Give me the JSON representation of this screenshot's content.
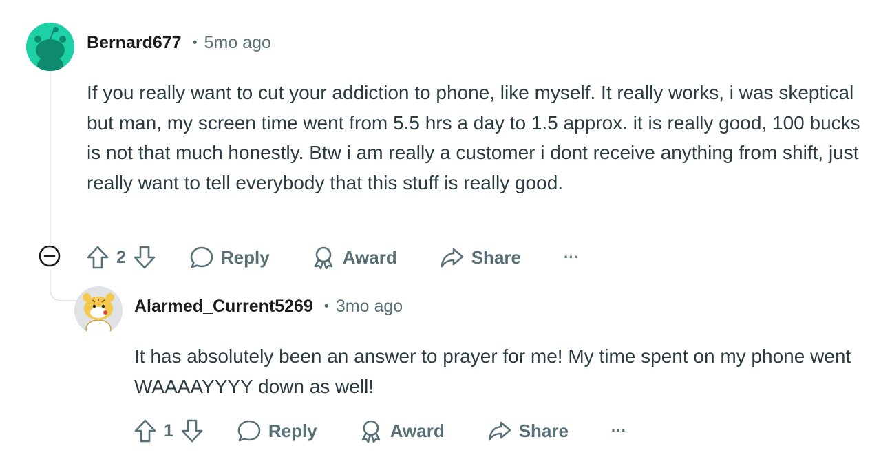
{
  "comments": [
    {
      "username": "Bernard677",
      "separator": "•",
      "time": "5mo ago",
      "body": "If you really want to cut your addiction to phone, like myself. It really works, i was skeptical but man, my screen time went from 5.5 hrs a day to 1.5 approx. it is really good, 100 bucks is not that much honestly. Btw i am really a customer i dont receive anything from shift, just really want to tell everybody that this stuff is really good.",
      "votes": "2",
      "reply_label": "Reply",
      "award_label": "Award",
      "share_label": "Share",
      "more_label": "···",
      "avatar_color": "#1dd0a6"
    },
    {
      "username": "Alarmed_Current5269",
      "separator": "•",
      "time": "3mo ago",
      "body": "It has absolutely been an answer to prayer for me! My time spent on my phone went WAAAAYYYY down as well!",
      "votes": "1",
      "reply_label": "Reply",
      "award_label": "Award",
      "share_label": "Share",
      "more_label": "···",
      "avatar_color": "#dfe3e6"
    }
  ],
  "icons": {
    "upvote": "arrow-up-icon",
    "downvote": "arrow-down-icon",
    "reply": "speech-bubble-icon",
    "award": "award-ribbon-icon",
    "share": "share-arrow-icon",
    "collapse": "minus-circle-icon"
  },
  "colors": {
    "meta_text": "#576f76",
    "body_text": "#2a3c42",
    "thread_line": "#e5e7e9"
  }
}
